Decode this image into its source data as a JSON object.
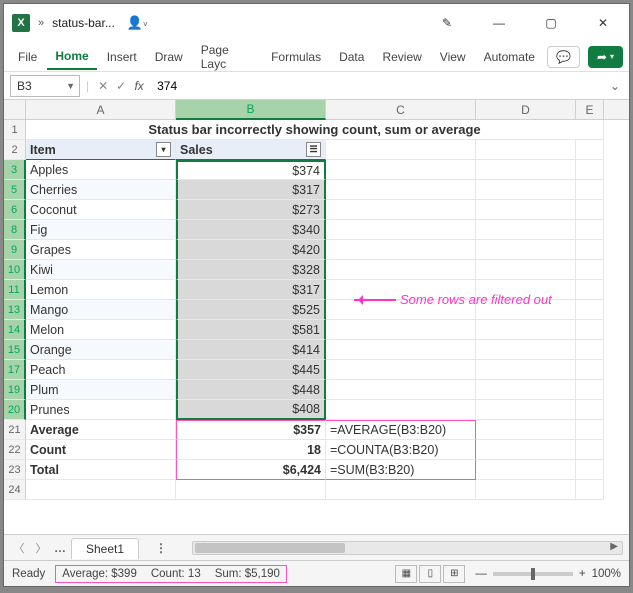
{
  "titlebar": {
    "filename": "status-bar..."
  },
  "ribbon": {
    "tabs": {
      "file": "File",
      "home": "Home",
      "insert": "Insert",
      "draw": "Draw",
      "pagelayout": "Page Layc",
      "formulas": "Formulas",
      "data": "Data",
      "review": "Review",
      "view": "View",
      "automate": "Automate"
    }
  },
  "formula_bar": {
    "name_box": "B3",
    "formula": "374"
  },
  "col_headers": {
    "A": "A",
    "B": "B",
    "C": "C",
    "D": "D",
    "E": "E"
  },
  "title_row": "Status bar incorrectly showing count, sum or average",
  "table_headers": {
    "item": "Item",
    "sales": "Sales"
  },
  "rows": [
    {
      "n": "3",
      "item": "Apples",
      "sales": "$374"
    },
    {
      "n": "5",
      "item": "Cherries",
      "sales": "$317"
    },
    {
      "n": "6",
      "item": "Coconut",
      "sales": "$273"
    },
    {
      "n": "8",
      "item": "Fig",
      "sales": "$340"
    },
    {
      "n": "9",
      "item": "Grapes",
      "sales": "$420"
    },
    {
      "n": "10",
      "item": "Kiwi",
      "sales": "$328"
    },
    {
      "n": "11",
      "item": "Lemon",
      "sales": "$317"
    },
    {
      "n": "13",
      "item": "Mango",
      "sales": "$525"
    },
    {
      "n": "14",
      "item": "Melon",
      "sales": "$581"
    },
    {
      "n": "15",
      "item": "Orange",
      "sales": "$414"
    },
    {
      "n": "17",
      "item": "Peach",
      "sales": "$445"
    },
    {
      "n": "19",
      "item": "Plum",
      "sales": "$448"
    },
    {
      "n": "20",
      "item": "Prunes",
      "sales": "$408"
    }
  ],
  "summary": [
    {
      "n": "21",
      "a": "Average",
      "b": "$357",
      "c": "=AVERAGE(B3:B20)"
    },
    {
      "n": "22",
      "a": "Count",
      "b": "18",
      "c": "=COUNTA(B3:B20)"
    },
    {
      "n": "23",
      "a": "Total",
      "b": "$6,424",
      "c": "=SUM(B3:B20)"
    }
  ],
  "blank_row": "24",
  "annotation": "Some rows are filtered out",
  "sheet_tab": "Sheet1",
  "statusbar": {
    "ready": "Ready",
    "average": "Average: $399",
    "count": "Count: 13",
    "sum": "Sum: $5,190",
    "zoom": "100%"
  }
}
